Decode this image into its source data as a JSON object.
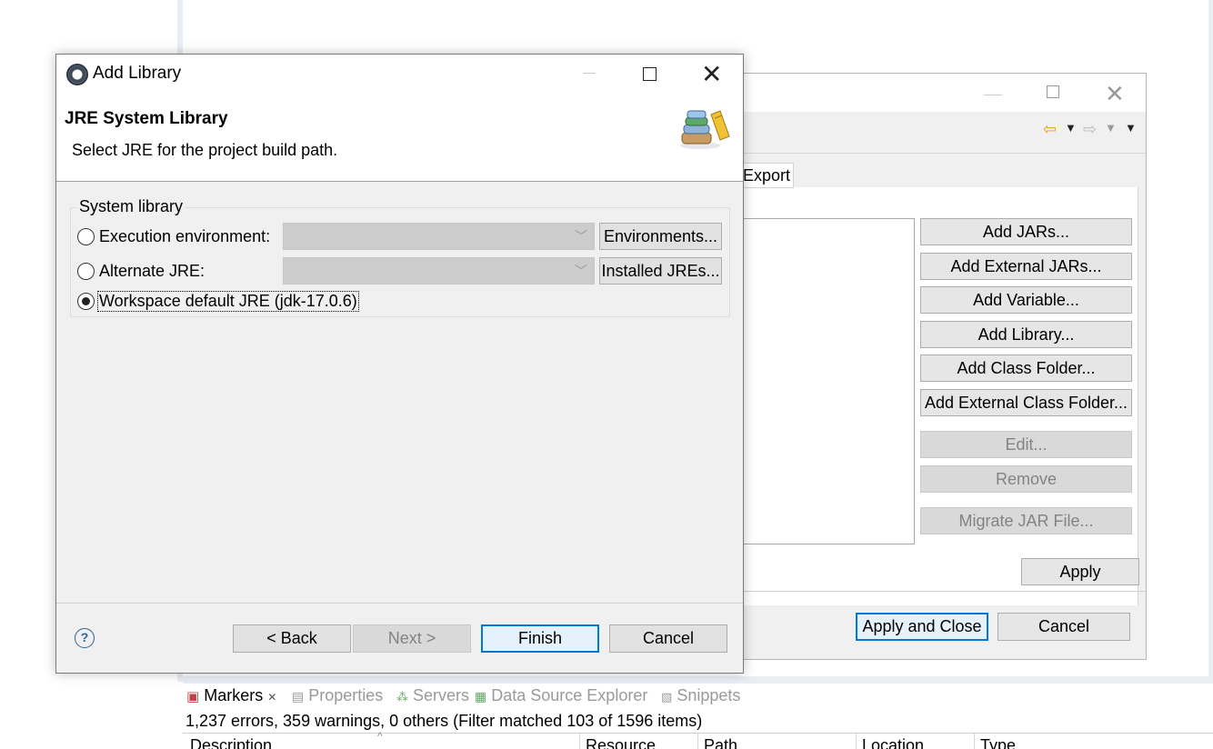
{
  "properties_dialog": {
    "tab_label": "Export",
    "buttons": {
      "add_jars": "Add JARs...",
      "add_external_jars": "Add External JARs...",
      "add_variable": "Add Variable...",
      "add_library": "Add Library...",
      "add_class_folder": "Add Class Folder...",
      "add_external_class_folder": "Add External Class Folder...",
      "edit": "Edit...",
      "remove": "Remove",
      "migrate_jar": "Migrate JAR File...",
      "apply": "Apply",
      "apply_and_close": "Apply and Close",
      "cancel": "Cancel"
    },
    "icons": [
      "back-arrow-icon",
      "dropdown-icon",
      "forward-arrow-icon",
      "view-menu-icon"
    ]
  },
  "add_library_dialog": {
    "title": "Add Library",
    "header_title": "JRE System Library",
    "header_description": "Select JRE for the project build path.",
    "group_label": "System library",
    "options": {
      "execution_environment": "Execution environment:",
      "alternate_jre": "Alternate JRE:",
      "workspace_default": "Workspace default JRE (jdk-17.0.6)"
    },
    "selected_option": "workspace_default",
    "buttons": {
      "environments": "Environments...",
      "installed_jres": "Installed JREs...",
      "back": "< Back",
      "next": "Next >",
      "finish": "Finish",
      "cancel": "Cancel"
    },
    "help_glyph": "?"
  },
  "markers_panel": {
    "tabs": [
      "Markers",
      "Properties",
      "Servers",
      "Data Source Explorer",
      "Snippets"
    ],
    "active_tab": "Markers",
    "summary": "1,237 errors, 359 warnings, 0 others (Filter matched 103 of 1596 items)",
    "columns": [
      "Description",
      "Resource",
      "Path",
      "Location",
      "Type"
    ]
  },
  "colors": {
    "dialog_bg": "#f0f0f0",
    "default_button_border": "#0078d7",
    "default_button_bg": "#e5f1fb",
    "disabled_text": "#838383"
  }
}
